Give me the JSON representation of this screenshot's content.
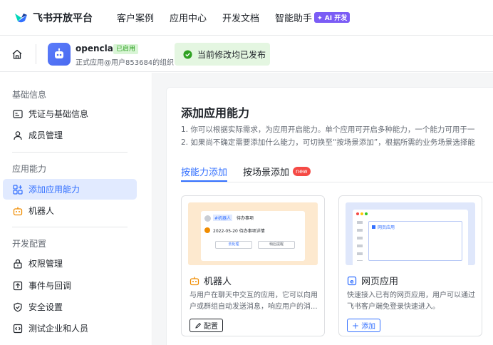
{
  "brand": {
    "name": "飞书开放平台"
  },
  "nav": {
    "items": [
      "客户案例",
      "应用中心",
      "开发文档"
    ],
    "ai_label": "智能助手",
    "ai_badge": "AI 开发"
  },
  "app": {
    "name": "openclaw",
    "status": "已启用",
    "subtitle": "正式应用@用户853684的组织",
    "publish_notice": "当前修改均已发布"
  },
  "sidebar": {
    "groups": [
      {
        "title": "基础信息",
        "items": [
          {
            "label": "凭证与基础信息",
            "icon": "credential-icon"
          },
          {
            "label": "成员管理",
            "icon": "user-icon"
          }
        ]
      },
      {
        "title": "应用能力",
        "items": [
          {
            "label": "添加应用能力",
            "icon": "add-grid-icon",
            "active": true
          },
          {
            "label": "机器人",
            "icon": "robot-icon"
          }
        ]
      },
      {
        "title": "开发配置",
        "items": [
          {
            "label": "权限管理",
            "icon": "lock-icon"
          },
          {
            "label": "事件与回调",
            "icon": "event-icon"
          },
          {
            "label": "安全设置",
            "icon": "shield-icon"
          },
          {
            "label": "测试企业和人员",
            "icon": "code-icon"
          }
        ]
      }
    ]
  },
  "main": {
    "title": "添加应用能力",
    "desc1": "1. 你可以根据实际需求，为应用开启能力。单个应用可开启多种能力，一个能力可用于一",
    "desc2": "2. 如果尚不确定需要添加什么能力，可切换至“按场景添加”，根据所需的业务场景选择能",
    "tabs": [
      {
        "label": "按能力添加",
        "active": true
      },
      {
        "label": "按场景添加",
        "badge": "new"
      }
    ],
    "cards": [
      {
        "title": "机器人",
        "icon": "robot-icon",
        "desc": "与用户在聊天中交互的应用，它可以向用户或群组自动发送消息，响应用户的消...",
        "button": "配置",
        "button_icon": "edit-icon",
        "preview": {
          "bot_tag": "#机器人",
          "bot_title": "待办事项",
          "date_line": "2022-05-20 待办事项详情",
          "btn1": "去处理",
          "btn2": "稍后提醒"
        }
      },
      {
        "title": "网页应用",
        "icon": "web-app-icon",
        "desc": "快速接入已有的网页应用，用户可以通过飞书客户端免登录快速进入。",
        "button": "添加",
        "button_icon": "plus-icon",
        "preview": {
          "window_title": "网页应用"
        }
      }
    ]
  },
  "colors": {
    "accent": "#3370ff",
    "active_bg": "#e1eaff",
    "success_bg": "#e4f6e1",
    "success": "#2ea121",
    "ai": "#7b5cf5",
    "new": "#f54a45"
  }
}
